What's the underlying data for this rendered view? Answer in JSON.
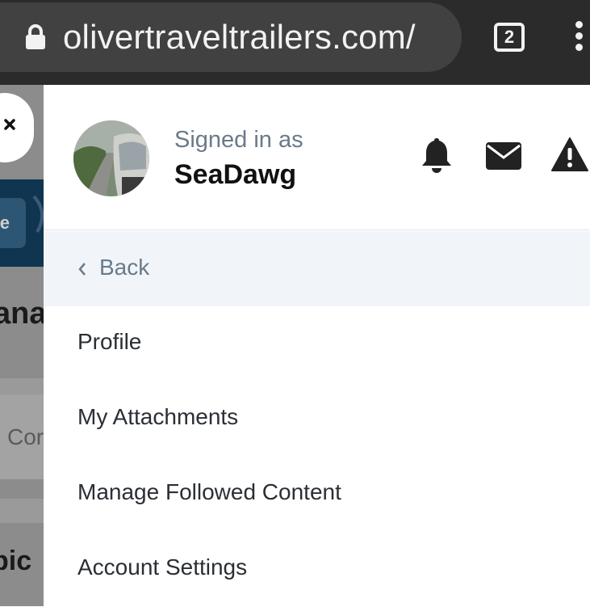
{
  "browser": {
    "url": "olivertraveltrailers.com/",
    "tab_count": "2",
    "lock_icon": "lock-icon",
    "menu_icon": "more-vert-icon"
  },
  "background": {
    "blue_button_text": "e",
    "heading_fragment": "ana",
    "content_fragment": "Cor",
    "topic_fragment": "pic"
  },
  "drawer": {
    "signed_in_label": "Signed in as",
    "username": "SeaDawg",
    "icons": [
      "bell-icon",
      "envelope-icon",
      "warning-icon"
    ],
    "back_label": "Back",
    "menu_items": [
      {
        "label": "Profile"
      },
      {
        "label": "My Attachments"
      },
      {
        "label": "Manage Followed Content"
      },
      {
        "label": "Account Settings"
      }
    ]
  },
  "colors": {
    "browser_bar": "#2b2b2b",
    "url_pill": "#414141",
    "back_row_bg": "#f1f5fa",
    "muted_text": "#6b7a8a",
    "menu_text": "#2a2f35"
  }
}
